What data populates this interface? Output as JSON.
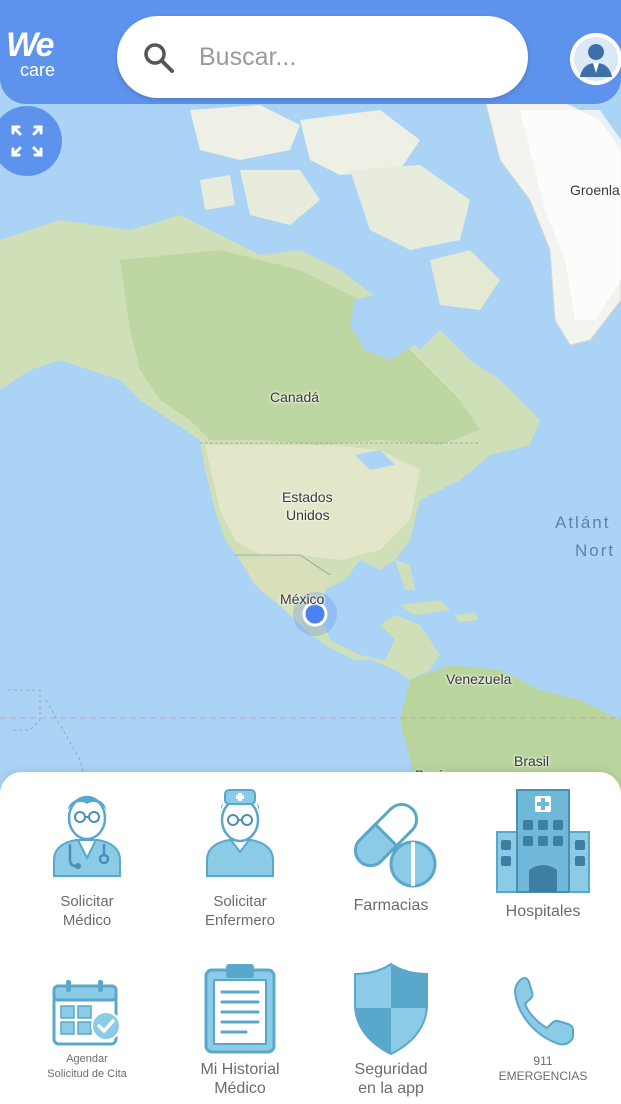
{
  "app": {
    "logo_we": "We",
    "logo_care": "care"
  },
  "search": {
    "placeholder": "Buscar...",
    "value": ""
  },
  "map": {
    "labels": {
      "greenland": "Groenla",
      "canada": "Canadá",
      "usa_line1": "Estados",
      "usa_line2": "Unidos",
      "mexico": "México",
      "venezuela": "Venezuela",
      "brasil": "Brasil",
      "peru": "Perú",
      "atlantic_line1": "Atlánt",
      "atlantic_line2": "Nort"
    }
  },
  "menu": {
    "items": [
      {
        "label": "Solicitar\nMédico",
        "icon": "doctor-icon"
      },
      {
        "label": "Solicitar\nEnfermero",
        "icon": "nurse-icon"
      },
      {
        "label": "Farmacias",
        "icon": "pill-icon"
      },
      {
        "label": "Hospitales",
        "icon": "hospital-icon"
      },
      {
        "label": "Agendar\nSolicitud de Cita",
        "icon": "calendar-icon"
      },
      {
        "label": "Mi Historial\nMédico",
        "icon": "clipboard-icon"
      },
      {
        "label": "Seguridad\nen la app",
        "icon": "shield-icon"
      },
      {
        "label": "911\nEMERGENCIAS",
        "icon": "phone-icon"
      }
    ]
  },
  "colors": {
    "brand": "#5d93ec",
    "icon_fill": "#8ccbe6",
    "icon_stroke": "#5aa7cc",
    "pin": "#d9363a",
    "location_dot": "#4a80f0"
  }
}
